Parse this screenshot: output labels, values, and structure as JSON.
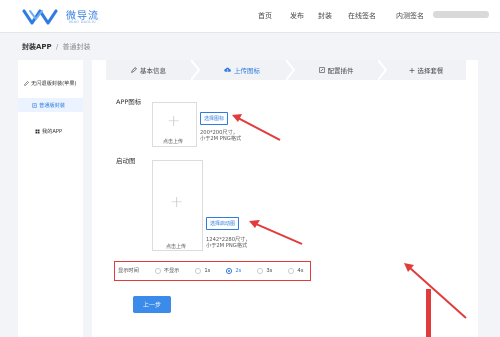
{
  "header": {
    "logo_text": "微导流",
    "logo_sub": "MIAO DAOLIU",
    "nav": [
      "首页",
      "发布",
      "封装",
      "在线签名",
      "内测签名"
    ]
  },
  "breadcrumb": {
    "root": "封装APP",
    "separator": "/",
    "current": "普通封装"
  },
  "sidebar": {
    "items": [
      {
        "label": "无闪退版封装(苹果)",
        "icon": "pen-icon"
      },
      {
        "label": "普通版封装",
        "icon": "file-icon",
        "active": true
      },
      {
        "label": "我的APP",
        "icon": "grid-icon"
      }
    ]
  },
  "steps": [
    {
      "label": "基本信息",
      "icon": "pen-icon"
    },
    {
      "label": "上传图标",
      "icon": "cloud-upload-icon",
      "active": true
    },
    {
      "label": "配置插件",
      "icon": "edit-icon"
    },
    {
      "label": "选择套餐",
      "icon": "plus-icon"
    }
  ],
  "app_icon": {
    "label": "APP图标",
    "upload_text": "点击上传",
    "button": "选择图标",
    "hint_line1": "200*200尺寸，",
    "hint_line2": "小于2M PNG格式"
  },
  "splash": {
    "label": "启动图",
    "upload_text": "点击上传",
    "button": "选择启动图",
    "hint_line1": "1242*2280尺寸，",
    "hint_line2": "小于2M PNG格式"
  },
  "display_time": {
    "label": "显示时间",
    "options": [
      "不显示",
      "1s",
      "2s",
      "3s",
      "4s"
    ],
    "selected": "2s"
  },
  "prev_button": "上一步",
  "colors": {
    "accent": "#2f7be0",
    "annotation": "#e23b3b"
  }
}
